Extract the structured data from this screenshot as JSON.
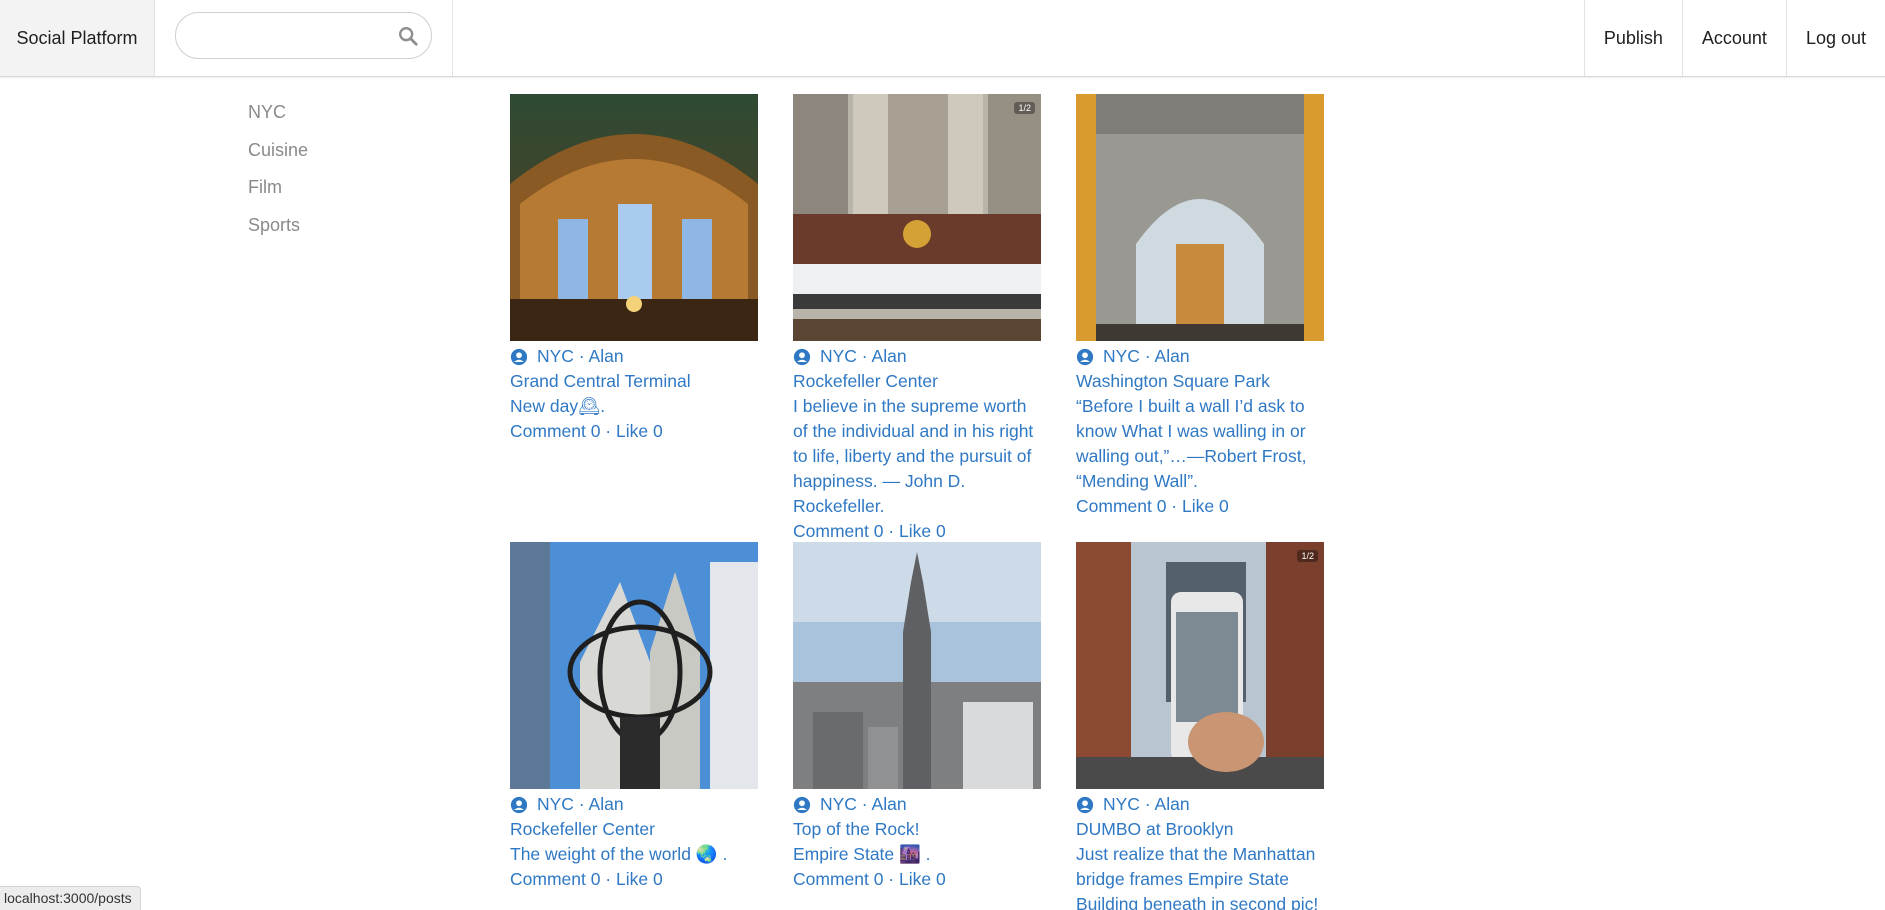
{
  "header": {
    "brand": "Social Platform",
    "search_placeholder": "",
    "nav": [
      "Publish",
      "Account",
      "Log out"
    ]
  },
  "sidebar": {
    "categories": [
      "NYC",
      "Cuisine",
      "Film",
      "Sports"
    ]
  },
  "posts": [
    {
      "category": "NYC",
      "author": "Alan",
      "meta": "NYC · Alan",
      "title": "Grand Central Terminal",
      "body": "New day🕰.",
      "stats": "Comment 0 · Like 0",
      "badge": ""
    },
    {
      "category": "NYC",
      "author": "Alan",
      "meta": "NYC · Alan",
      "title": "Rockefeller Center",
      "body": "I believe in the supreme worth of the individual and in his right to life, liberty and the pursuit of happiness. — John D. Rockefeller.",
      "stats": "Comment 0 · Like 0",
      "badge": "1/2"
    },
    {
      "category": "NYC",
      "author": "Alan",
      "meta": "NYC · Alan",
      "title": "Washington Square Park",
      "body": "“Before I built a wall I’d ask to know What I was walling in or walling out,”…—Robert Frost, “Mending Wall”.",
      "stats": "Comment 0 · Like 0",
      "badge": ""
    },
    {
      "category": "NYC",
      "author": "Alan",
      "meta": "NYC · Alan",
      "title": "Rockefeller Center",
      "body": "The weight of the world 🌏 .",
      "stats": "Comment 0 · Like 0",
      "badge": ""
    },
    {
      "category": "NYC",
      "author": "Alan",
      "meta": "NYC · Alan",
      "title": "Top of the Rock!",
      "body": "Empire State 🌆 .",
      "stats": "Comment 0 · Like 0",
      "badge": ""
    },
    {
      "category": "NYC",
      "author": "Alan",
      "meta": "NYC · Alan",
      "title": "DUMBO at Brooklyn",
      "body": "Just realize that the Manhattan bridge frames Empire State Building beneath in second pic!",
      "stats": "",
      "badge": "1/2"
    }
  ],
  "statusbar": {
    "url": "localhost:3000/posts"
  },
  "colors": {
    "link": "#2f78c4",
    "muted": "#8a8a8a"
  }
}
